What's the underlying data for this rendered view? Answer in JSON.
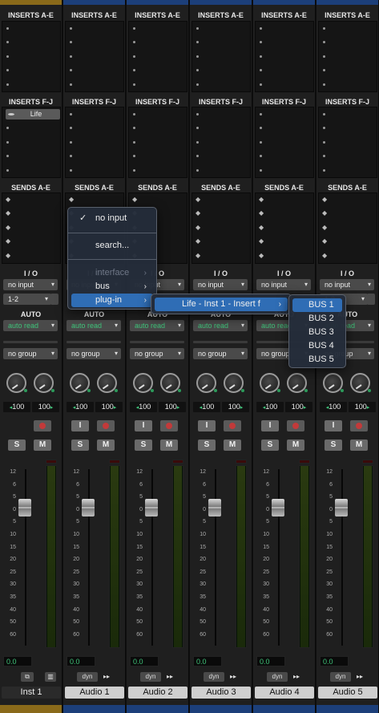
{
  "colors": {
    "inst_color": "#8a6a1a",
    "audio_color": "#1c3f7a",
    "green_text": "#3fc47a",
    "menu_highlight": "#2f6db5"
  },
  "labels": {
    "inserts_ae": "INSERTS A-E",
    "inserts_fj": "INSERTS F-J",
    "sends_ae": "SENDS A-E",
    "io": "I / O",
    "auto": "AUTO",
    "solo": "S",
    "mute": "M",
    "input": "I"
  },
  "scale_ticks": [
    "12",
    "6",
    "5",
    "0",
    "5",
    "10",
    "15",
    "20",
    "25",
    "30",
    "35",
    "40",
    "50",
    "60"
  ],
  "tracks": [
    {
      "name": "Inst 1",
      "type": "instrument",
      "insert_fj_plugin": "Life",
      "input": "no input",
      "output": "1-2",
      "automation": "auto read",
      "group": "no group",
      "pan_left": "100",
      "pan_right": "100",
      "volume": "0.0",
      "footer": "",
      "has_output_dd": true
    },
    {
      "name": "Audio 1",
      "type": "audio",
      "input": "no input",
      "output": "",
      "automation": "auto read",
      "group": "no group",
      "pan_left": "100",
      "pan_right": "100",
      "volume": "0.0",
      "footer": "dyn",
      "has_output_dd": false
    },
    {
      "name": "Audio 2",
      "type": "audio",
      "input": "no input",
      "output": "",
      "automation": "auto read",
      "group": "no group",
      "pan_left": "100",
      "pan_right": "100",
      "volume": "0.0",
      "footer": "dyn",
      "has_output_dd": false
    },
    {
      "name": "Audio 3",
      "type": "audio",
      "input": "no input",
      "output": "",
      "automation": "auto read",
      "group": "no group",
      "pan_left": "100",
      "pan_right": "100",
      "volume": "0.0",
      "footer": "dyn",
      "has_output_dd": false
    },
    {
      "name": "Audio 4",
      "type": "audio",
      "input": "no input",
      "output": "",
      "automation": "auto read",
      "group": "no group",
      "pan_left": "100",
      "pan_right": "100",
      "volume": "0.0",
      "footer": "dyn",
      "has_output_dd": false
    },
    {
      "name": "Audio 5",
      "type": "audio",
      "input": "no input",
      "output": "1-2",
      "automation": "auto read",
      "group": "no group",
      "pan_left": "100",
      "pan_right": "100",
      "volume": "0.0",
      "footer": "dyn",
      "has_output_dd": true
    }
  ],
  "input_menu": {
    "items": [
      {
        "label": "no input",
        "checked": true
      },
      {
        "label": "search..."
      },
      {
        "label": "interface",
        "disabled": true,
        "submenu": true
      },
      {
        "label": "bus",
        "submenu": true
      },
      {
        "label": "plug-in",
        "submenu": true,
        "selected": true
      }
    ]
  },
  "plugin_submenu": {
    "items": [
      {
        "label": "Life - Inst 1 - Insert f",
        "submenu": true,
        "selected": true
      }
    ]
  },
  "bus_submenu": {
    "items": [
      {
        "label": "BUS 1",
        "selected": true
      },
      {
        "label": "BUS 2"
      },
      {
        "label": "BUS 3"
      },
      {
        "label": "BUS 4"
      },
      {
        "label": "BUS 5"
      }
    ]
  }
}
